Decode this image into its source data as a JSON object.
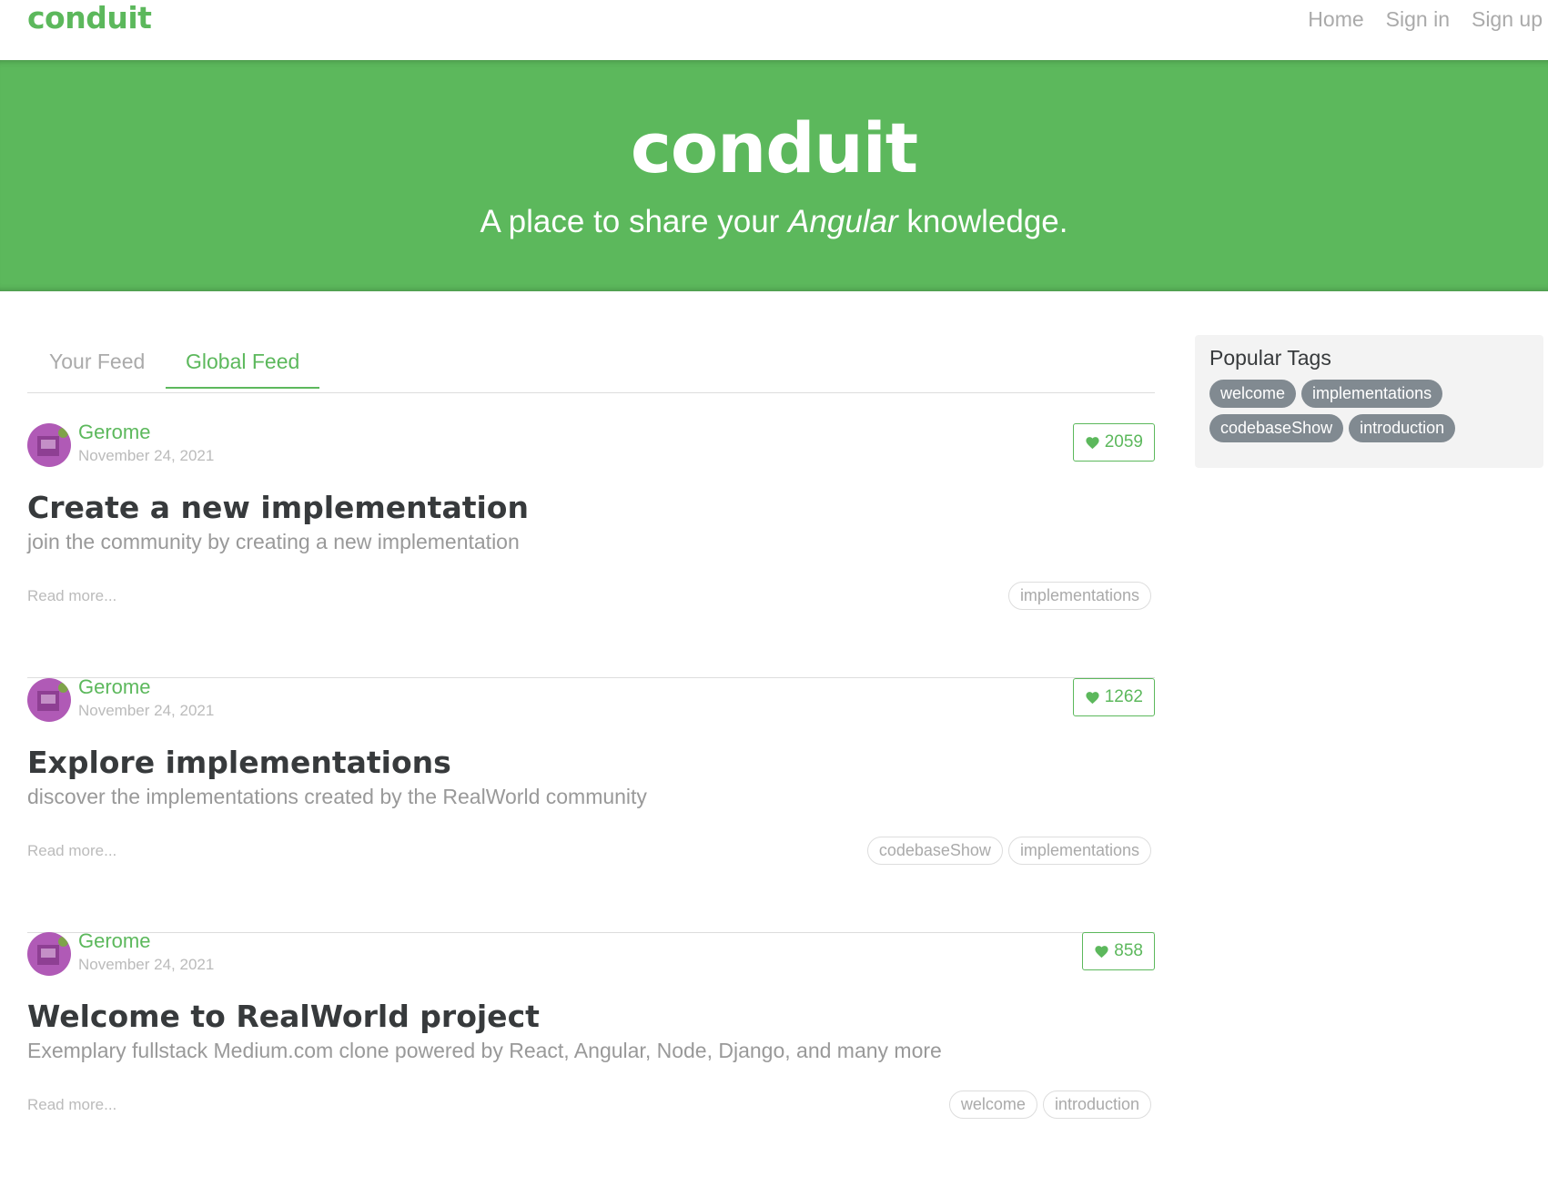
{
  "navbar": {
    "brand": "conduit",
    "links": [
      "Home",
      "Sign in",
      "Sign up"
    ]
  },
  "banner": {
    "title": "conduit",
    "subtitle_before": "A place to share your ",
    "subtitle_em": "Angular",
    "subtitle_after": " knowledge."
  },
  "feed": {
    "tabs": [
      "Your Feed",
      "Global Feed"
    ],
    "active_tab": "Global Feed"
  },
  "articles": [
    {
      "author": "Gerome",
      "date": "November 24, 2021",
      "favorites": "2059",
      "title": "Create a new implementation",
      "description": "join the community by creating a new implementation",
      "read_more": "Read more...",
      "tags": [
        "implementations"
      ]
    },
    {
      "author": "Gerome",
      "date": "November 24, 2021",
      "favorites": "1262",
      "title": "Explore implementations",
      "description": "discover the implementations created by the RealWorld community",
      "read_more": "Read more...",
      "tags": [
        "codebaseShow",
        "implementations"
      ]
    },
    {
      "author": "Gerome",
      "date": "November 24, 2021",
      "favorites": "858",
      "title": "Welcome to RealWorld project",
      "description": "Exemplary fullstack Medium.com clone powered by React, Angular, Node, Django, and many more",
      "read_more": "Read more...",
      "tags": [
        "welcome",
        "introduction"
      ]
    }
  ],
  "sidebar": {
    "title": "Popular Tags",
    "tags": [
      "welcome",
      "implementations",
      "codebaseShow",
      "introduction"
    ]
  },
  "colors": {
    "brand_green": "#5cb85c",
    "tag_pill": "#818a91",
    "sidebar_bg": "#f3f3f3"
  }
}
